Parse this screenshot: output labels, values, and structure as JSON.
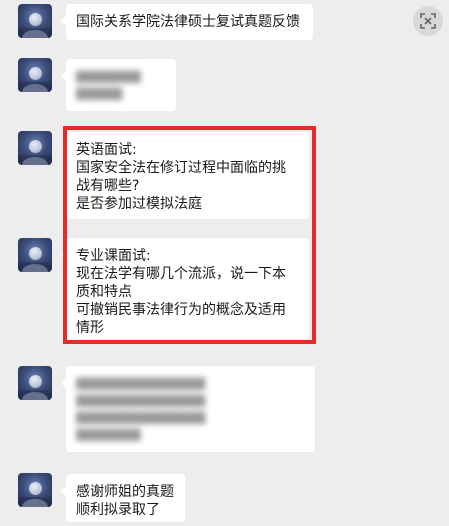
{
  "messages": [
    {
      "id": "msg1",
      "text": "国际关系学院法律硕士复试真题反馈",
      "blurred": false
    },
    {
      "id": "msg2",
      "text": "",
      "blurred": true
    },
    {
      "id": "msg3",
      "text": "英语面试:\n国家安全法在修订过程中面临的挑战有哪些?\n是否参加过模拟法庭",
      "blurred": false,
      "highlighted": true
    },
    {
      "id": "msg4",
      "text": "专业课面试:\n现在法学有哪几个流派，说一下本质和特点\n可撤销民事法律行为的概念及适用情形",
      "blurred": false,
      "highlighted": true
    },
    {
      "id": "msg5",
      "text": "",
      "blurred": true
    },
    {
      "id": "msg6",
      "text": "感谢师姐的真题\n顺利拟录取了",
      "blurred": false
    }
  ],
  "ui": {
    "close_icon": "close-icon",
    "highlight_color": "#e52b2b",
    "bubble_color": "#ffffff",
    "background_color": "#ededed"
  }
}
